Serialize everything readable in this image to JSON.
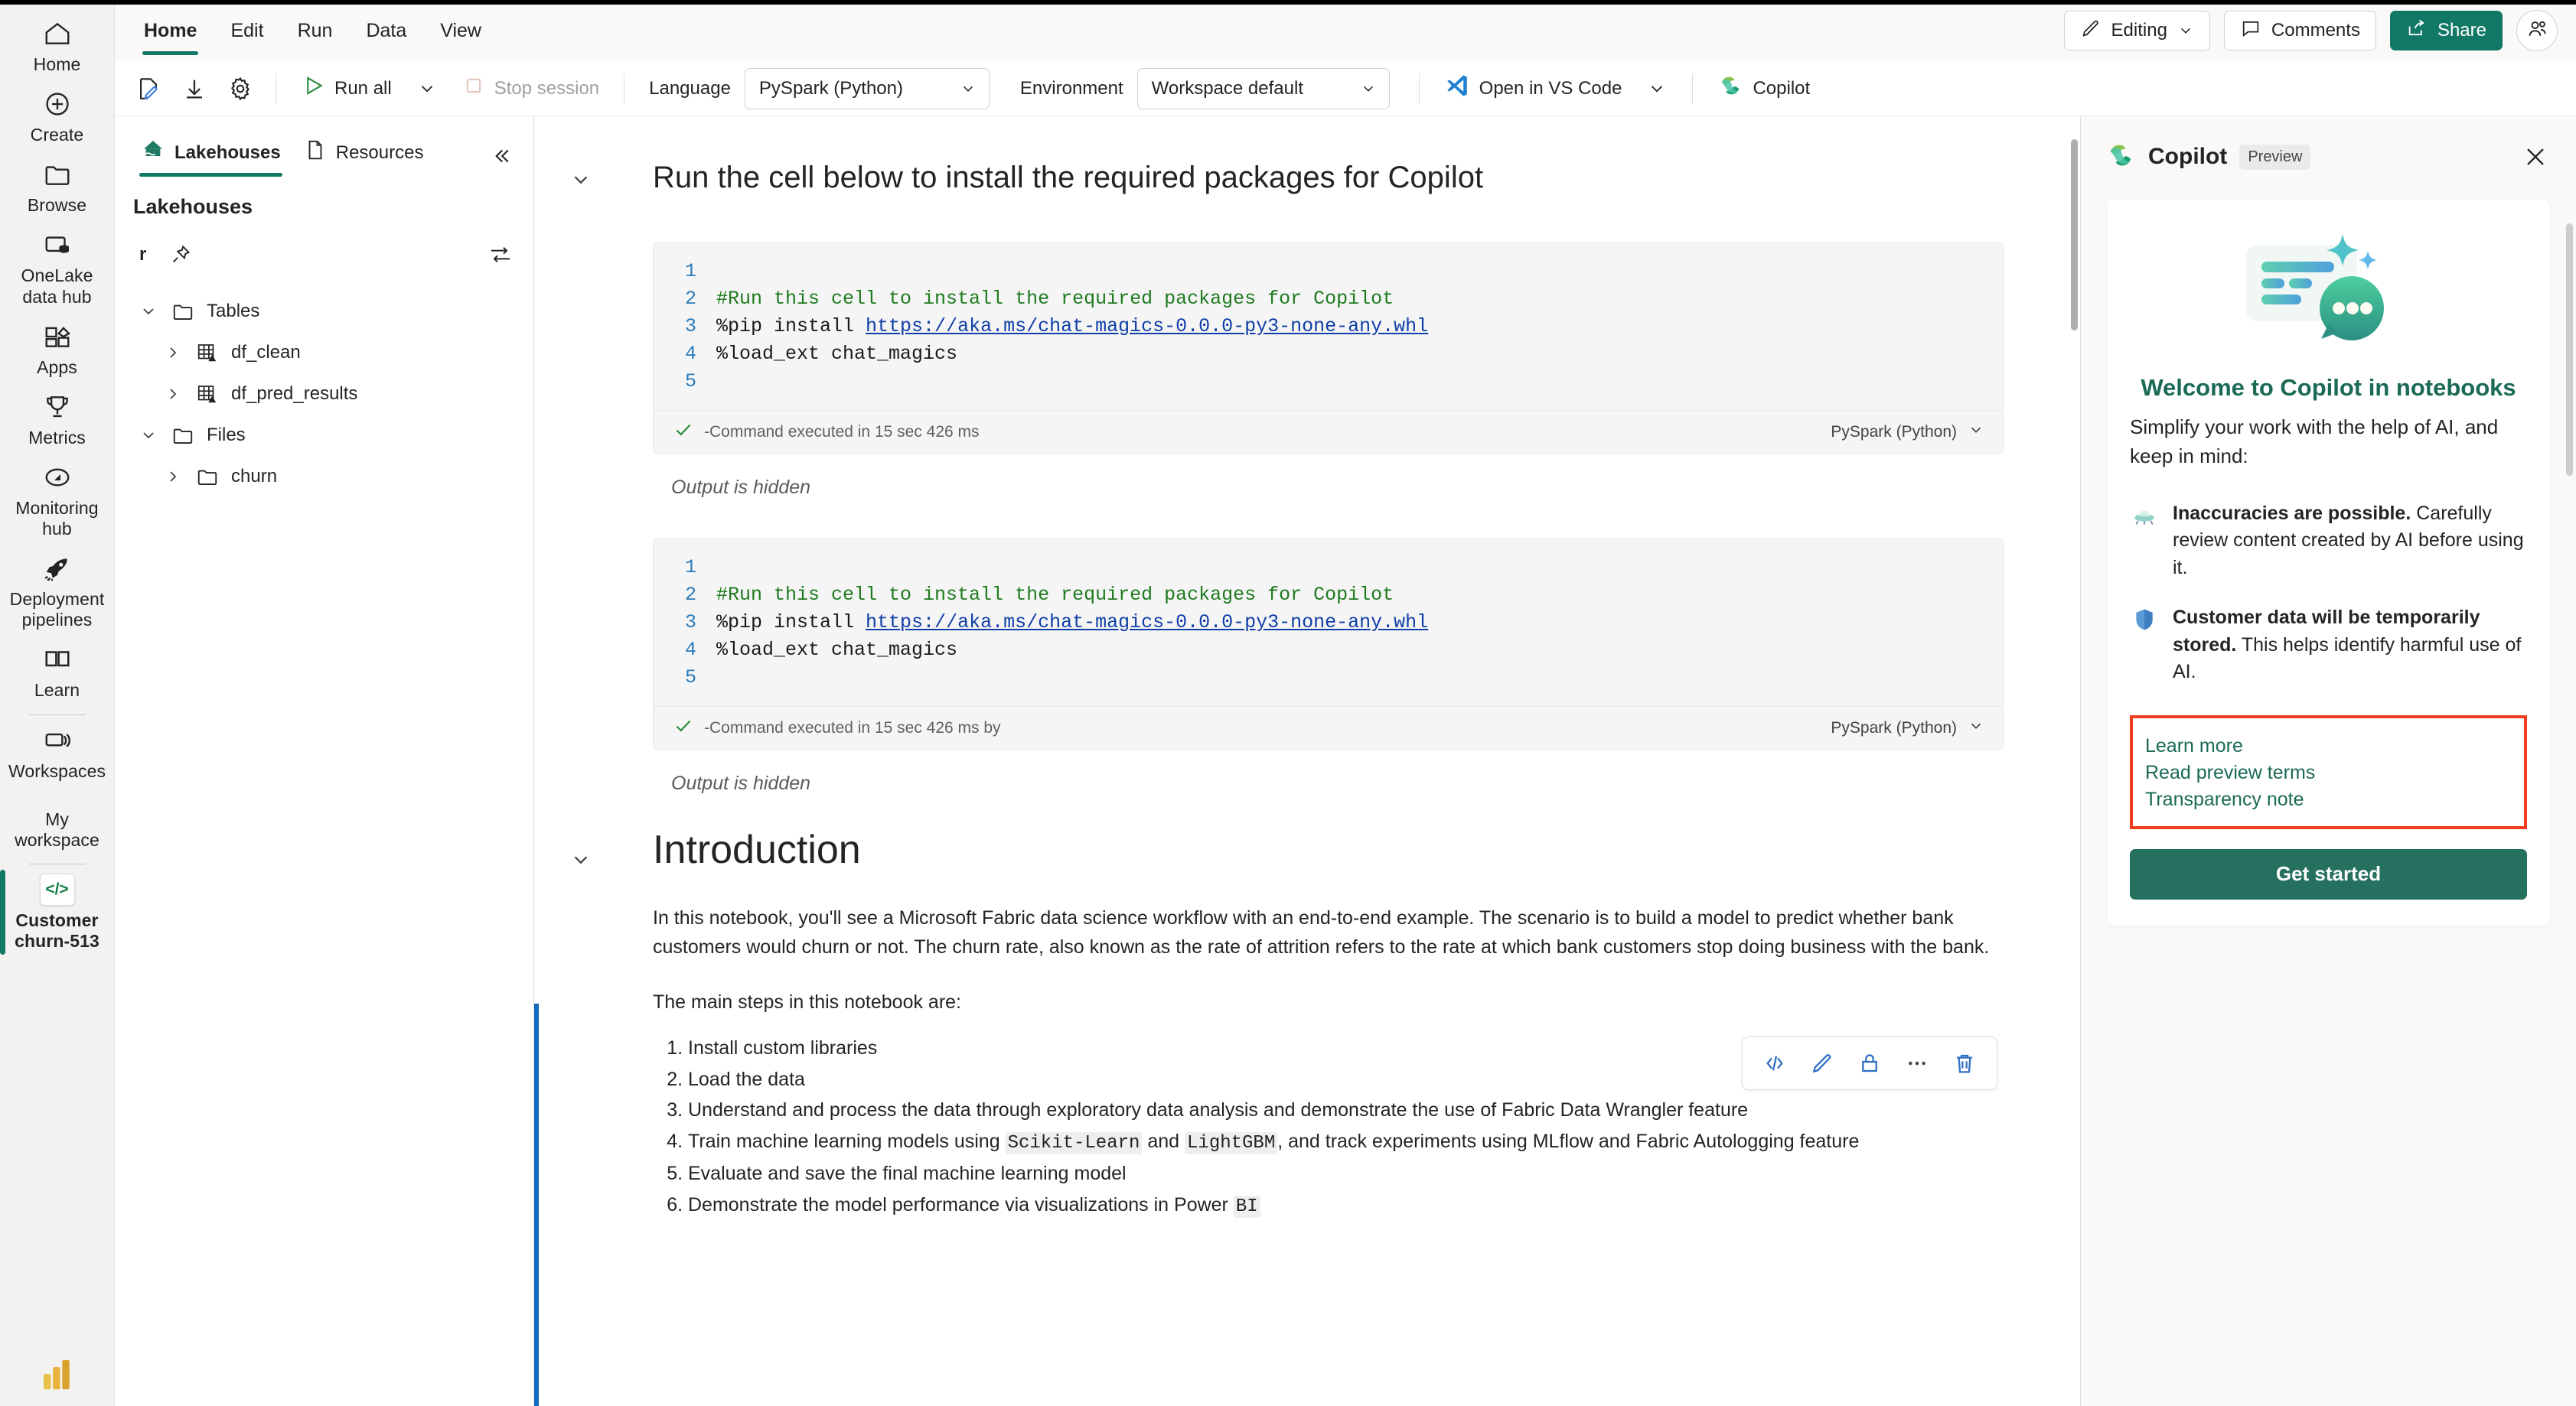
{
  "rail": {
    "items": [
      {
        "label": "Home",
        "icon": "home-icon"
      },
      {
        "label": "Create",
        "icon": "plus-circle-icon"
      },
      {
        "label": "Browse",
        "icon": "folder-icon"
      },
      {
        "label": "OneLake\ndata hub",
        "icon": "onelake-icon"
      },
      {
        "label": "Apps",
        "icon": "apps-icon"
      },
      {
        "label": "Metrics",
        "icon": "trophy-icon"
      },
      {
        "label": "Monitoring\nhub",
        "icon": "monitoring-icon"
      },
      {
        "label": "Deployment\npipelines",
        "icon": "rocket-icon"
      },
      {
        "label": "Learn",
        "icon": "book-icon"
      },
      {
        "label": "Workspaces",
        "icon": "workspaces-icon"
      }
    ],
    "my_workspace": "My\nworkspace",
    "active_item": {
      "label": "Customer\nchurn-513",
      "icon": "notebook-icon",
      "glyph": "</>"
    }
  },
  "ribbon": {
    "tabs": [
      {
        "label": "Home",
        "active": true
      },
      {
        "label": "Edit",
        "active": false
      },
      {
        "label": "Run",
        "active": false
      },
      {
        "label": "Data",
        "active": false
      },
      {
        "label": "View",
        "active": false
      }
    ],
    "editing_label": "Editing",
    "comments_label": "Comments",
    "share_label": "Share"
  },
  "toolbar": {
    "run_all_label": "Run all",
    "stop_session_label": "Stop session",
    "language_label": "Language",
    "language_value": "PySpark (Python)",
    "environment_label": "Environment",
    "environment_value": "Workspace default",
    "vscode_label": "Open in VS Code",
    "copilot_label": "Copilot"
  },
  "explorer": {
    "tabs": [
      {
        "label": "Lakehouses",
        "active": true,
        "icon": "lakehouse-icon"
      },
      {
        "label": "Resources",
        "active": false,
        "icon": "document-icon"
      }
    ],
    "section_title": "Lakehouses",
    "lakehouse_name": "r",
    "tree": [
      {
        "level": 1,
        "label": "Tables",
        "icon": "folder-icon",
        "twisty": "down"
      },
      {
        "level": 2,
        "label": "df_clean",
        "icon": "table-icon",
        "twisty": "right"
      },
      {
        "level": 2,
        "label": "df_pred_results",
        "icon": "table-icon",
        "twisty": "right"
      },
      {
        "level": 1,
        "label": "Files",
        "icon": "folder-icon",
        "twisty": "down"
      },
      {
        "level": 2,
        "label": "churn",
        "icon": "folder-icon",
        "twisty": "right"
      }
    ]
  },
  "notebook": {
    "heading_1": "Run the cell below to install the required packages for Copilot",
    "cell_1": {
      "lines": [
        {
          "n": "1",
          "text": "",
          "type": "plain"
        },
        {
          "n": "2",
          "text": "#Run this cell to install the required packages for Copilot",
          "type": "comment"
        },
        {
          "n": "3",
          "text": "%pip install ",
          "link": "https://aka.ms/chat-magics-0.0.0-py3-none-any.whl",
          "type": "link"
        },
        {
          "n": "4",
          "text": "%load_ext chat_magics",
          "type": "plain"
        },
        {
          "n": "5",
          "text": "",
          "type": "plain"
        }
      ],
      "status": "-Command executed in 15 sec 426 ms",
      "kernel": "PySpark (Python)",
      "output_note": "Output is hidden"
    },
    "cell_2": {
      "lines": [
        {
          "n": "1",
          "text": "",
          "type": "plain"
        },
        {
          "n": "2",
          "text": "#Run this cell to install the required packages for Copilot",
          "type": "comment"
        },
        {
          "n": "3",
          "text": "%pip install ",
          "link": "https://aka.ms/chat-magics-0.0.0-py3-none-any.whl",
          "type": "link"
        },
        {
          "n": "4",
          "text": "%load_ext chat_magics",
          "type": "plain"
        },
        {
          "n": "5",
          "text": "",
          "type": "plain"
        }
      ],
      "status": "-Command executed in 15 sec 426 ms by",
      "kernel": "PySpark (Python)",
      "output_note": "Output is hidden"
    },
    "cell_toolbar": [
      {
        "icon": "code-icon",
        "name": "convert-to-code-button"
      },
      {
        "icon": "pencil-icon",
        "name": "edit-cell-button"
      },
      {
        "icon": "lock-icon",
        "name": "freeze-cell-button"
      },
      {
        "icon": "ellipsis-icon",
        "name": "more-options-button"
      },
      {
        "icon": "trash-icon",
        "name": "delete-cell-button"
      }
    ],
    "intro_heading": "Introduction",
    "intro_p1": "In this notebook, you'll see a Microsoft Fabric data science workflow with an end-to-end example. The scenario is to build a model to predict whether bank customers would churn or not. The churn rate, also known as the rate of attrition refers to the rate at which bank customers stop doing business with the bank.",
    "intro_p2": "The main steps in this notebook are:",
    "steps": [
      {
        "pre": "Install custom libraries",
        "code1": "",
        "mid": "",
        "code2": "",
        "post": ""
      },
      {
        "pre": "Load the data",
        "code1": "",
        "mid": "",
        "code2": "",
        "post": ""
      },
      {
        "pre": "Understand and process the data through exploratory data analysis and demonstrate the use of Fabric Data Wrangler feature",
        "code1": "",
        "mid": "",
        "code2": "",
        "post": ""
      },
      {
        "pre": "Train machine learning models using ",
        "code1": "Scikit-Learn",
        "mid": " and ",
        "code2": "LightGBM",
        "post": ", and track experiments using MLflow and Fabric Autologging feature"
      },
      {
        "pre": "Evaluate and save the final machine learning model",
        "code1": "",
        "mid": "",
        "code2": "",
        "post": ""
      },
      {
        "pre": "Demonstrate the model performance via visualizations in Power ",
        "code1": "BI",
        "mid": "",
        "code2": "",
        "post": ""
      }
    ]
  },
  "copilot": {
    "title": "Copilot",
    "preview_badge": "Preview",
    "welcome": "Welcome to Copilot in notebooks",
    "subtitle": "Simplify your work with the help of AI, and keep in mind:",
    "bullets": [
      {
        "emoji": "🛸",
        "bold": "Inaccuracies are possible.",
        "text": "Carefully review content created by AI before using it."
      },
      {
        "emoji": "🛡",
        "bold": "Customer data will be temporarily stored.",
        "text": "This helps identify harmful use of AI."
      }
    ],
    "links": [
      "Learn more",
      "Read preview terms",
      "Transparency note"
    ],
    "get_started": "Get started"
  },
  "colors": {
    "accent_green": "#117865",
    "link_green": "#1a6a56",
    "highlight_red": "#f03e20",
    "cell_blue": "#0f6cbd"
  }
}
